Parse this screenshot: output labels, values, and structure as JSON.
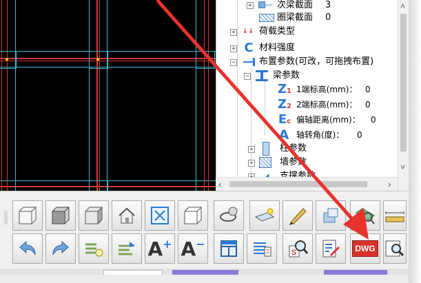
{
  "tree": {
    "items": [
      {
        "label": "次梁截面",
        "count": "3"
      },
      {
        "label": "圈梁截面",
        "count": "0"
      },
      {
        "label": "荷载类型"
      },
      {
        "label": "材料强度"
      },
      {
        "label": "布置参数(可改，可拖拽布置)"
      },
      {
        "label": "梁参数"
      },
      {
        "label": "1端标高(mm)：",
        "value": "0"
      },
      {
        "label": "2端标高(mm)：",
        "value": "0"
      },
      {
        "label": "偏轴距离(mm)：",
        "value": "0"
      },
      {
        "label": "轴转角(度)：",
        "value": "0"
      },
      {
        "label": "柱参数"
      },
      {
        "label": "墙参数"
      },
      {
        "label": "支撑参数"
      }
    ],
    "icon_letters": {
      "z1": "Z",
      "z1_sub": "1",
      "z2": "Z",
      "z2_sub": "2",
      "ec": "E",
      "ec_sub": "c",
      "a": "A",
      "c": "C"
    },
    "expand_plus": "+",
    "expand_minus": "−"
  },
  "scrollbars": {
    "left_arrow": "‹",
    "right_arrow": "›",
    "up_arrow": "˄",
    "down_arrow": "˅"
  },
  "toolbar": {
    "row1": [
      "front-view-cube",
      "iso-view-cube",
      "side-view-cube",
      "home-view",
      "zoom-extents",
      "wireframe-cube",
      "orbit-rotate",
      "light-plane",
      "pencil-eraser",
      "move-object",
      "layer-move",
      "ruler-measure"
    ],
    "row2": [
      "undo",
      "redo",
      "layer-filter",
      "layer-switch",
      "font-increase",
      "font-decrease",
      "grid-window",
      "property-list",
      "search-select",
      "checklist-edit",
      "dwg-export",
      "print-preview"
    ],
    "font_increase_label": "A",
    "font_increase_sup": "+",
    "font_decrease_label": "A",
    "font_decrease_sup": "−",
    "dwg_label": "DWG",
    "search_s": "S"
  },
  "annotation": {
    "arrow_color": "#e8332d"
  },
  "colors": {
    "accent": "#2a7ad5",
    "grid_cyan": "#3fb8d8",
    "grid_red": "#d83a3a"
  }
}
